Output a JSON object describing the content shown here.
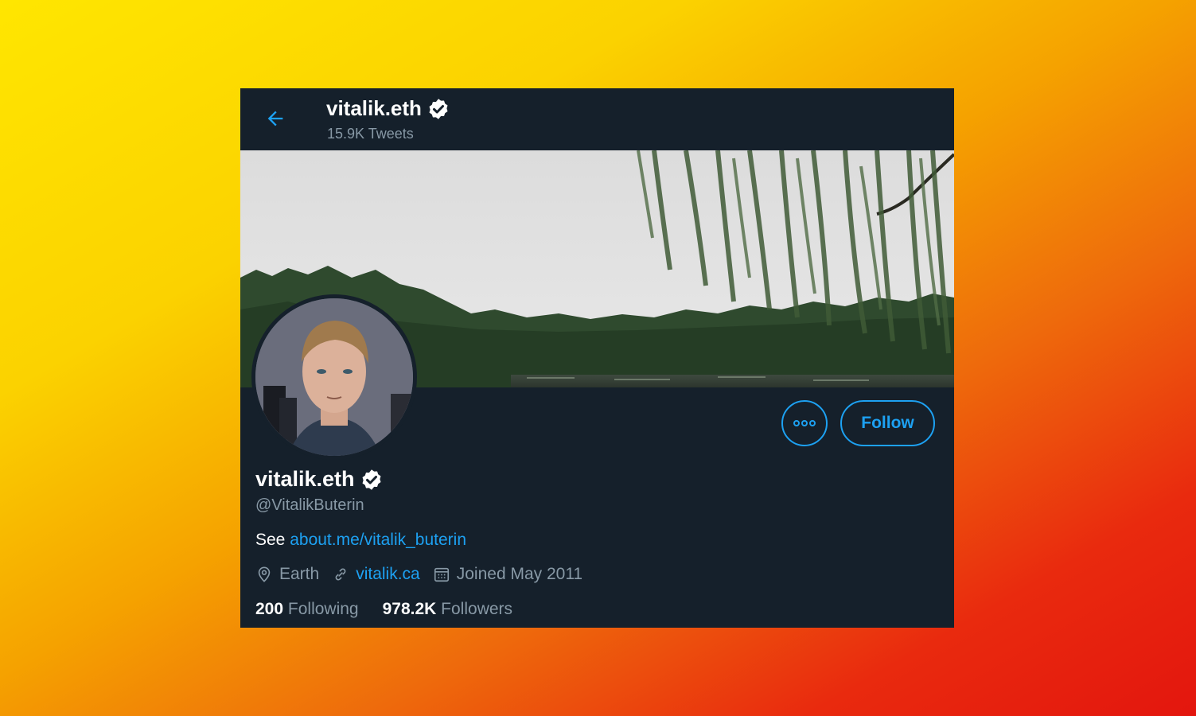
{
  "header": {
    "title": "vitalik.eth",
    "tweet_count": "15.9K Tweets",
    "back_icon": "arrow-left-icon",
    "verified_icon": "verified-badge-icon"
  },
  "profile": {
    "display_name": "vitalik.eth",
    "handle": "@VitalikButerin",
    "bio_prefix": "See",
    "bio_link": "about.me/vitalik_buterin",
    "location": "Earth",
    "website": "vitalik.ca",
    "joined": "Joined May 2011",
    "following_count": "200",
    "following_label": "Following",
    "followers_count": "978.2K",
    "followers_label": "Followers"
  },
  "actions": {
    "more_icon": "more-options-icon",
    "follow_label": "Follow"
  },
  "colors": {
    "card_bg": "#15202b",
    "accent": "#1da1f2",
    "muted_text": "#8899a6",
    "text": "#ffffff"
  }
}
